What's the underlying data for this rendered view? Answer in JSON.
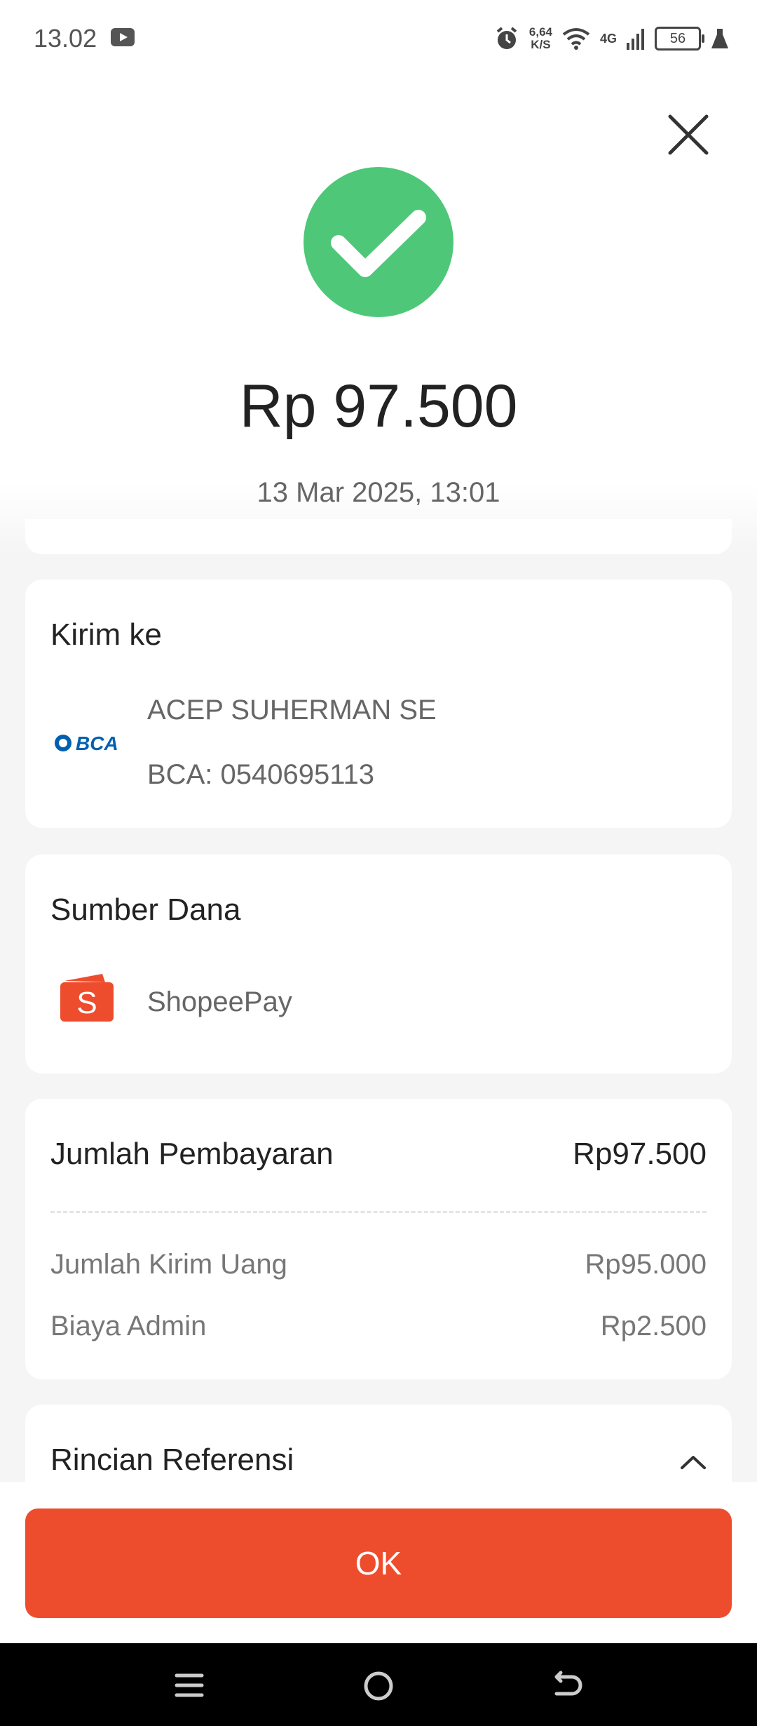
{
  "status_bar": {
    "time": "13.02",
    "net_speed_value": "6,64",
    "net_speed_unit": "K/S",
    "signal": "4G",
    "battery": "56"
  },
  "header": {
    "amount": "Rp 97.500",
    "datetime": "13 Mar 2025, 13:01"
  },
  "kirim_ke": {
    "title": "Kirim ke",
    "bank_logo_text": "BCA",
    "recipient_name": "ACEP SUHERMAN SE",
    "account": "BCA: 0540695113"
  },
  "sumber_dana": {
    "title": "Sumber Dana",
    "source": "ShopeePay"
  },
  "payment": {
    "title": "Jumlah Pembayaran",
    "total": "Rp97.500",
    "rows": [
      {
        "label": "Jumlah Kirim Uang",
        "value": "Rp95.000"
      },
      {
        "label": "Biaya Admin",
        "value": "Rp2.500"
      }
    ]
  },
  "referensi": {
    "title": "Rincian Referensi"
  },
  "ok_button": {
    "label": "OK"
  },
  "colors": {
    "primary": "#ee4d2d",
    "success": "#4ec878",
    "background": "#f5f5f5"
  }
}
